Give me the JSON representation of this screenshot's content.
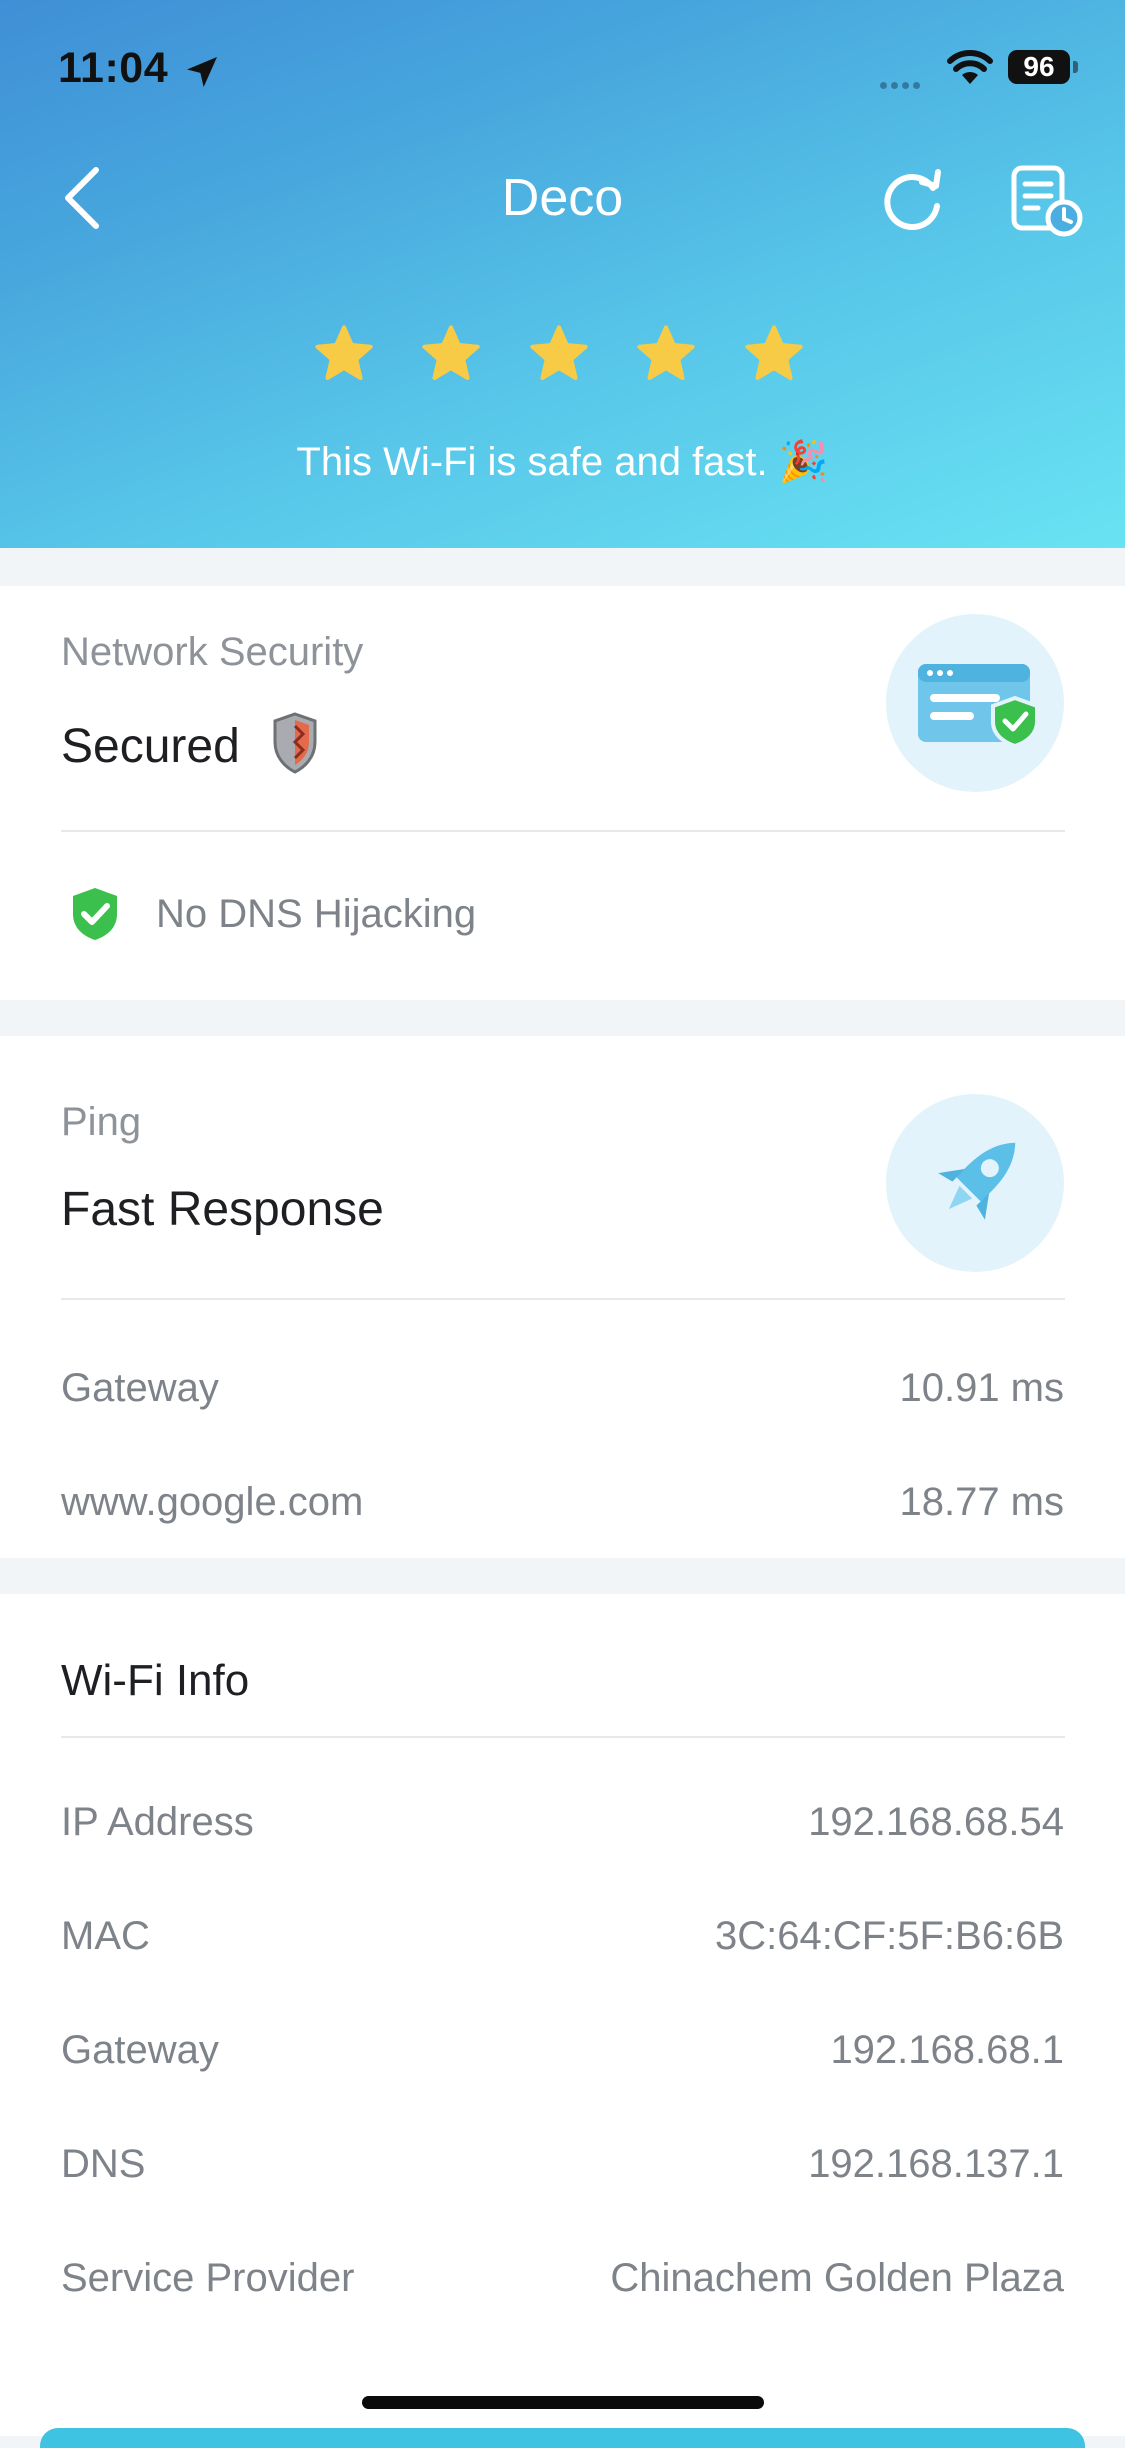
{
  "status_bar": {
    "time": "11:04",
    "battery": "96"
  },
  "header": {
    "title": "Deco",
    "rating": 5,
    "summary": "This Wi-Fi is safe and fast. 🎉"
  },
  "security": {
    "label": "Network Security",
    "status": "Secured",
    "check_label": "No DNS Hijacking"
  },
  "ping": {
    "label": "Ping",
    "status": "Fast Response",
    "rows": [
      {
        "label": "Gateway",
        "value": "10.91 ms"
      },
      {
        "label": "www.google.com",
        "value": "18.77 ms"
      }
    ]
  },
  "wifi_info": {
    "title": "Wi-Fi Info",
    "rows": [
      {
        "label": "IP Address",
        "value": "192.168.68.54"
      },
      {
        "label": "MAC",
        "value": "3C:64:CF:5F:B6:6B"
      },
      {
        "label": "Gateway",
        "value": "192.168.68.1"
      },
      {
        "label": "DNS",
        "value": "192.168.137.1"
      },
      {
        "label": "Service Provider",
        "value": "Chinachem Golden Plaza"
      }
    ]
  },
  "colors": {
    "header_gradient_start": "#3f8fd6",
    "header_gradient_end": "#69e3f3",
    "star": "#f7cb45",
    "secure_green": "#3bbf4d",
    "accent_blue": "#5bbfe8"
  },
  "icons": {
    "back": "chevron-left-icon",
    "refresh": "refresh-icon",
    "history": "history-report-icon",
    "security_badge": "browser-shield-icon",
    "ping_badge": "rocket-icon",
    "dns": "shield-check-icon"
  }
}
